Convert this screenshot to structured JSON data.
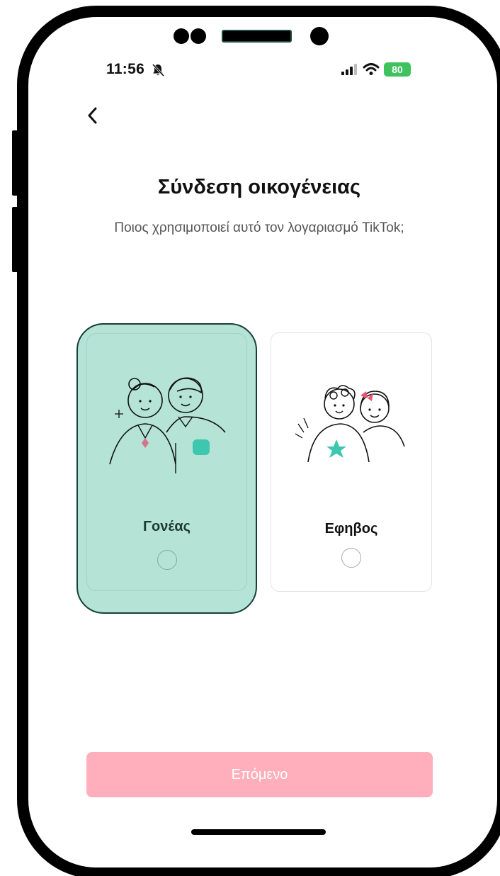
{
  "status_bar": {
    "time": "11:56",
    "battery": "80"
  },
  "icons": {
    "back": "chevron-left-icon",
    "silent": "bell-slash-icon",
    "signal": "cellular-signal-icon",
    "wifi": "wifi-icon",
    "battery": "battery-charging-icon"
  },
  "header": {
    "title": "Σύνδεση οικογένειας",
    "subtitle": "Ποιος χρησιμοποιεί αυτό τον λογαριασμό TikTok;"
  },
  "options": [
    {
      "label": "Γονέας",
      "selected": true
    },
    {
      "label": "Εφηβος",
      "selected": false
    }
  ],
  "footer": {
    "next_label": "Επόμενο"
  },
  "colors": {
    "selected_card": "#b5e3d6",
    "selected_border": "#173f36",
    "next_button": "#ffaebb",
    "battery": "#3fc25d",
    "accent_teal": "#3cc7ae",
    "accent_pink": "#f0526f"
  }
}
